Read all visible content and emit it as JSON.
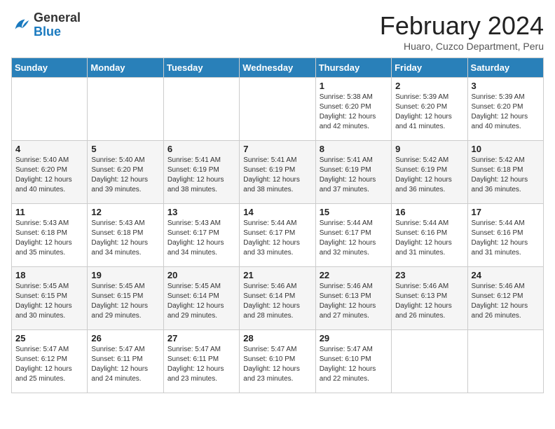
{
  "logo": {
    "general": "General",
    "blue": "Blue"
  },
  "title": "February 2024",
  "subtitle": "Huaro, Cuzco Department, Peru",
  "days_header": [
    "Sunday",
    "Monday",
    "Tuesday",
    "Wednesday",
    "Thursday",
    "Friday",
    "Saturday"
  ],
  "weeks": [
    [
      {
        "day": "",
        "info": ""
      },
      {
        "day": "",
        "info": ""
      },
      {
        "day": "",
        "info": ""
      },
      {
        "day": "",
        "info": ""
      },
      {
        "day": "1",
        "info": "Sunrise: 5:38 AM\nSunset: 6:20 PM\nDaylight: 12 hours\nand 42 minutes."
      },
      {
        "day": "2",
        "info": "Sunrise: 5:39 AM\nSunset: 6:20 PM\nDaylight: 12 hours\nand 41 minutes."
      },
      {
        "day": "3",
        "info": "Sunrise: 5:39 AM\nSunset: 6:20 PM\nDaylight: 12 hours\nand 40 minutes."
      }
    ],
    [
      {
        "day": "4",
        "info": "Sunrise: 5:40 AM\nSunset: 6:20 PM\nDaylight: 12 hours\nand 40 minutes."
      },
      {
        "day": "5",
        "info": "Sunrise: 5:40 AM\nSunset: 6:20 PM\nDaylight: 12 hours\nand 39 minutes."
      },
      {
        "day": "6",
        "info": "Sunrise: 5:41 AM\nSunset: 6:19 PM\nDaylight: 12 hours\nand 38 minutes."
      },
      {
        "day": "7",
        "info": "Sunrise: 5:41 AM\nSunset: 6:19 PM\nDaylight: 12 hours\nand 38 minutes."
      },
      {
        "day": "8",
        "info": "Sunrise: 5:41 AM\nSunset: 6:19 PM\nDaylight: 12 hours\nand 37 minutes."
      },
      {
        "day": "9",
        "info": "Sunrise: 5:42 AM\nSunset: 6:19 PM\nDaylight: 12 hours\nand 36 minutes."
      },
      {
        "day": "10",
        "info": "Sunrise: 5:42 AM\nSunset: 6:18 PM\nDaylight: 12 hours\nand 36 minutes."
      }
    ],
    [
      {
        "day": "11",
        "info": "Sunrise: 5:43 AM\nSunset: 6:18 PM\nDaylight: 12 hours\nand 35 minutes."
      },
      {
        "day": "12",
        "info": "Sunrise: 5:43 AM\nSunset: 6:18 PM\nDaylight: 12 hours\nand 34 minutes."
      },
      {
        "day": "13",
        "info": "Sunrise: 5:43 AM\nSunset: 6:17 PM\nDaylight: 12 hours\nand 34 minutes."
      },
      {
        "day": "14",
        "info": "Sunrise: 5:44 AM\nSunset: 6:17 PM\nDaylight: 12 hours\nand 33 minutes."
      },
      {
        "day": "15",
        "info": "Sunrise: 5:44 AM\nSunset: 6:17 PM\nDaylight: 12 hours\nand 32 minutes."
      },
      {
        "day": "16",
        "info": "Sunrise: 5:44 AM\nSunset: 6:16 PM\nDaylight: 12 hours\nand 31 minutes."
      },
      {
        "day": "17",
        "info": "Sunrise: 5:44 AM\nSunset: 6:16 PM\nDaylight: 12 hours\nand 31 minutes."
      }
    ],
    [
      {
        "day": "18",
        "info": "Sunrise: 5:45 AM\nSunset: 6:15 PM\nDaylight: 12 hours\nand 30 minutes."
      },
      {
        "day": "19",
        "info": "Sunrise: 5:45 AM\nSunset: 6:15 PM\nDaylight: 12 hours\nand 29 minutes."
      },
      {
        "day": "20",
        "info": "Sunrise: 5:45 AM\nSunset: 6:14 PM\nDaylight: 12 hours\nand 29 minutes."
      },
      {
        "day": "21",
        "info": "Sunrise: 5:46 AM\nSunset: 6:14 PM\nDaylight: 12 hours\nand 28 minutes."
      },
      {
        "day": "22",
        "info": "Sunrise: 5:46 AM\nSunset: 6:13 PM\nDaylight: 12 hours\nand 27 minutes."
      },
      {
        "day": "23",
        "info": "Sunrise: 5:46 AM\nSunset: 6:13 PM\nDaylight: 12 hours\nand 26 minutes."
      },
      {
        "day": "24",
        "info": "Sunrise: 5:46 AM\nSunset: 6:12 PM\nDaylight: 12 hours\nand 26 minutes."
      }
    ],
    [
      {
        "day": "25",
        "info": "Sunrise: 5:47 AM\nSunset: 6:12 PM\nDaylight: 12 hours\nand 25 minutes."
      },
      {
        "day": "26",
        "info": "Sunrise: 5:47 AM\nSunset: 6:11 PM\nDaylight: 12 hours\nand 24 minutes."
      },
      {
        "day": "27",
        "info": "Sunrise: 5:47 AM\nSunset: 6:11 PM\nDaylight: 12 hours\nand 23 minutes."
      },
      {
        "day": "28",
        "info": "Sunrise: 5:47 AM\nSunset: 6:10 PM\nDaylight: 12 hours\nand 23 minutes."
      },
      {
        "day": "29",
        "info": "Sunrise: 5:47 AM\nSunset: 6:10 PM\nDaylight: 12 hours\nand 22 minutes."
      },
      {
        "day": "",
        "info": ""
      },
      {
        "day": "",
        "info": ""
      }
    ]
  ]
}
